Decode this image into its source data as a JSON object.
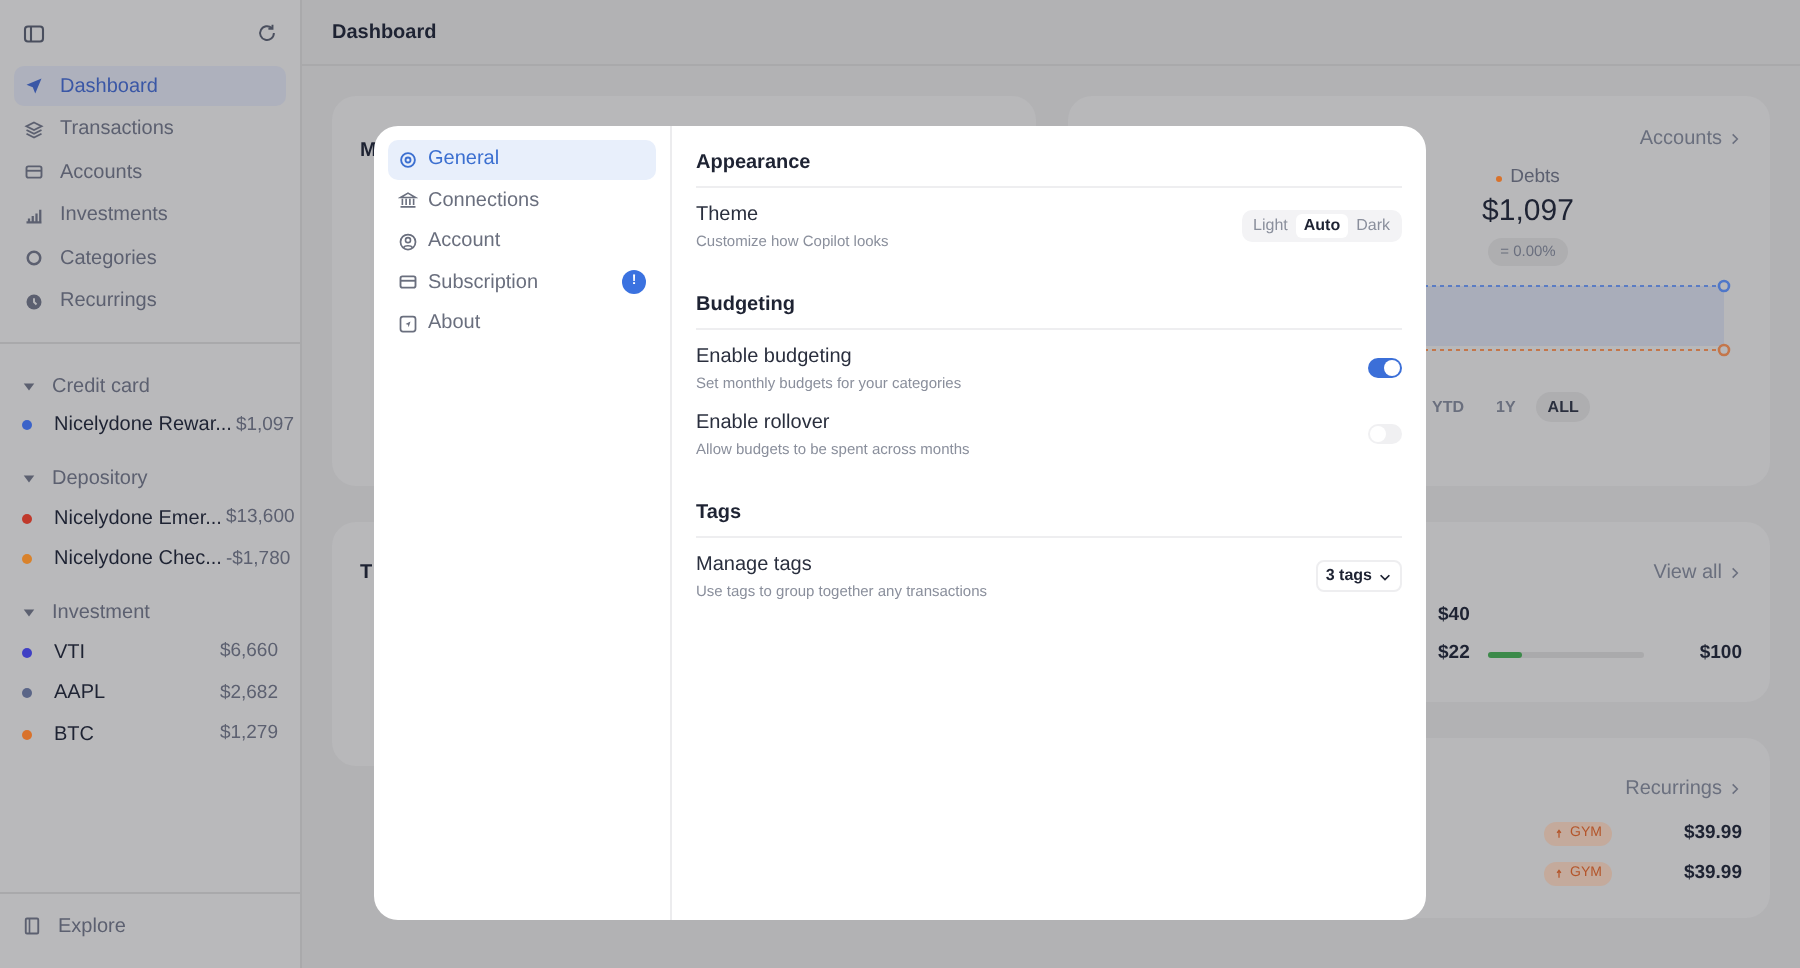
{
  "sidebar": {
    "nav": [
      {
        "label": "Dashboard",
        "selected": true
      },
      {
        "label": "Transactions",
        "selected": false
      },
      {
        "label": "Accounts",
        "selected": false
      },
      {
        "label": "Investments",
        "selected": false
      },
      {
        "label": "Categories",
        "selected": false
      },
      {
        "label": "Recurrings",
        "selected": false
      }
    ],
    "groups": [
      {
        "label": "Credit card",
        "expanded": true,
        "accounts": [
          {
            "name": "Nicelydone Rewar...",
            "amount": "$1,097",
            "color": "#3b63c9"
          }
        ]
      },
      {
        "label": "Depository",
        "expanded": true,
        "accounts": [
          {
            "name": "Nicelydone Emer...",
            "amount": "$13,600",
            "color": "#c0392b"
          },
          {
            "name": "Nicelydone Chec...",
            "amount": "-$1,780",
            "color": "#d9822b"
          }
        ]
      },
      {
        "label": "Investment",
        "expanded": true,
        "accounts": [
          {
            "name": "VTI",
            "amount": "$6,660",
            "color": "#3f3fc4"
          },
          {
            "name": "AAPL",
            "amount": "$2,682",
            "color": "#5a6587"
          },
          {
            "name": "BTC",
            "amount": "$1,279",
            "color": "#d9722b"
          }
        ]
      }
    ],
    "footer": [
      {
        "label": "Explore"
      }
    ]
  },
  "header": {
    "title": "Dashboard"
  },
  "cards": {
    "card_1": {
      "title": "M"
    },
    "networth": {
      "link": "Accounts",
      "legend": "Debts",
      "value": "$1,097",
      "change": "= 0.00%",
      "ranges": [
        {
          "label": "YTD",
          "selected": false
        },
        {
          "label": "1Y",
          "selected": false
        },
        {
          "label": "ALL",
          "selected": true
        }
      ]
    },
    "card_3": {
      "title": "T"
    },
    "budgets": {
      "link": "View all",
      "rows": [
        {
          "spent": "$40"
        },
        {
          "spent": "$22",
          "level": 0.22,
          "limit": "$100"
        }
      ]
    },
    "recurrings": {
      "link": "Recurrings",
      "rows": [
        {
          "tag": "GYM",
          "amount": "$39.99"
        },
        {
          "tag": "GYM",
          "amount": "$39.99"
        }
      ]
    }
  },
  "settings": {
    "nav": [
      {
        "label": "General",
        "selected": true
      },
      {
        "label": "Connections",
        "selected": false
      },
      {
        "label": "Account",
        "selected": false
      },
      {
        "label": "Subscription",
        "selected": false,
        "badge": "!"
      },
      {
        "label": "About",
        "selected": false
      }
    ],
    "sections": [
      {
        "title": "Appearance",
        "rows": [
          {
            "kind": "segmented",
            "title": "Theme",
            "description": "Customize how Copilot looks",
            "options": [
              {
                "label": "Light",
                "selected": false
              },
              {
                "label": "Auto",
                "selected": true
              },
              {
                "label": "Dark",
                "selected": false
              }
            ]
          }
        ]
      },
      {
        "title": "Budgeting",
        "rows": [
          {
            "kind": "toggle",
            "title": "Enable budgeting",
            "description": "Set monthly budgets for your categories",
            "on": true
          },
          {
            "kind": "toggle",
            "title": "Enable rollover",
            "description": "Allow budgets to be spent across months",
            "on": false
          }
        ]
      },
      {
        "title": "Tags",
        "rows": [
          {
            "kind": "dropdown",
            "title": "Manage tags",
            "description": "Use tags to group together any transactions",
            "value": "3 tags"
          }
        ]
      }
    ]
  }
}
